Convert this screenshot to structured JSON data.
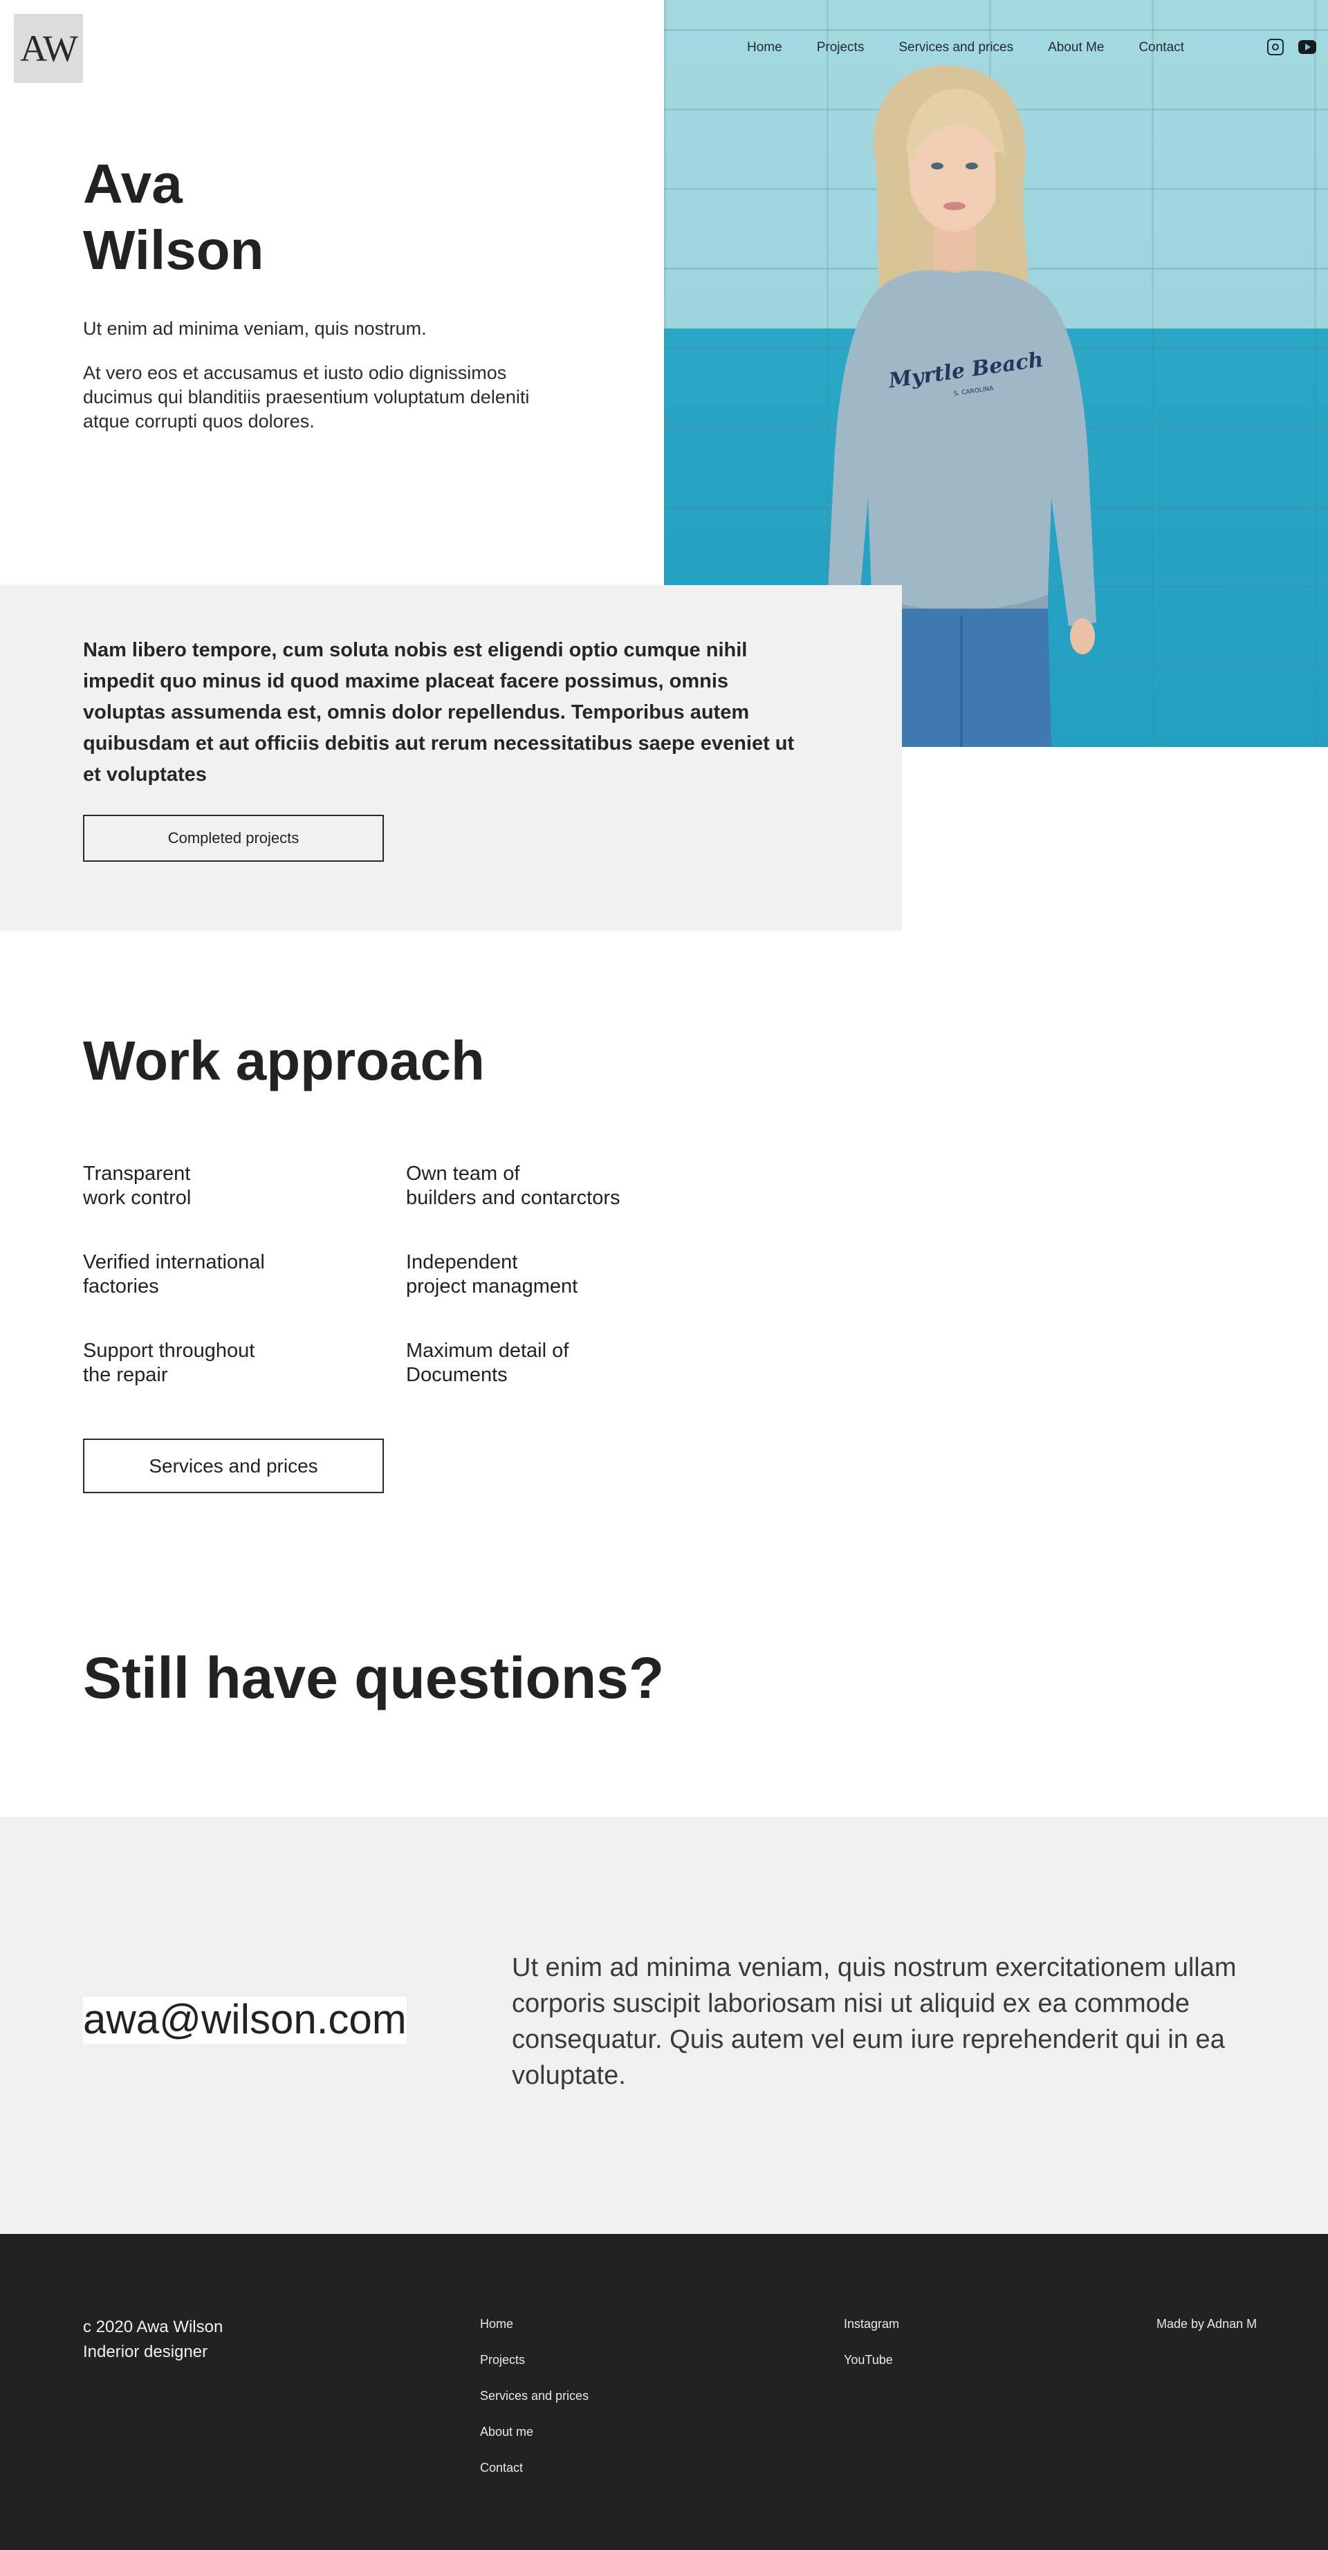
{
  "logo": {
    "text": "AW"
  },
  "nav": {
    "items": [
      "Home",
      "Projects",
      "Services and prices",
      "About Me",
      "Contact"
    ],
    "social": [
      "instagram-icon",
      "youtube-icon"
    ]
  },
  "hero": {
    "name_line1": "Ava",
    "name_line2": "Wilson",
    "lead": "Ut enim ad minima veniam, quis nostrum.",
    "paragraph": "At vero eos et accusamus et iusto odio dignissimos ducimus qui blanditiis praesentium voluptatum deleniti atque corrupti quos dolores.",
    "photo_caption": "Myrtle Beach",
    "photo_subcaption": "S. CAROLINA"
  },
  "intro": {
    "text": "Nam libero tempore, cum soluta nobis est eligendi optio cumque nihil impedit quo minus id quod maxime placeat facere possimus, omnis voluptas assumenda est, omnis dolor repellendus. Temporibus autem quibusdam et aut officiis debitis aut rerum necessitatibus saepe eveniet ut et voluptates",
    "button": "Completed projects"
  },
  "work": {
    "title": "Work approach",
    "features": [
      {
        "line1": "Transparent",
        "line2": "work control"
      },
      {
        "line1": "Own team of",
        "line2": "builders and contarctors"
      },
      {
        "line1": "Verified international",
        "line2": "factories"
      },
      {
        "line1": "Independent",
        "line2": "project managment"
      },
      {
        "line1": "Support throughout",
        "line2": "the repair"
      },
      {
        "line1": "Maximum detail of",
        "line2": "Documents"
      }
    ],
    "button": "Services and prices"
  },
  "questions": {
    "title": "Still have questions?"
  },
  "contact": {
    "email": "awa@wilson.com",
    "text": "Ut enim ad minima veniam, quis nostrum exercitationem ullam corporis suscipit laboriosam nisi ut aliquid ex ea commode consequatur. Quis autem vel eum iure reprehenderit qui in ea voluptate."
  },
  "footer": {
    "copy_line1": "c 2020 Awa Wilson",
    "copy_line2": "Inderior designer",
    "links": [
      "Home",
      "Projects",
      "Services and prices",
      "About me",
      "Contact"
    ],
    "social_links": [
      "Instagram",
      "YouTube"
    ],
    "made_by": "Made by Adnan M"
  },
  "colors": {
    "text": "#222222",
    "grey_block": "#f1f1f1",
    "footer_bg": "#222222",
    "photo_wall_light": "#a3d8df",
    "photo_wall_dark": "#2aa6c6"
  }
}
